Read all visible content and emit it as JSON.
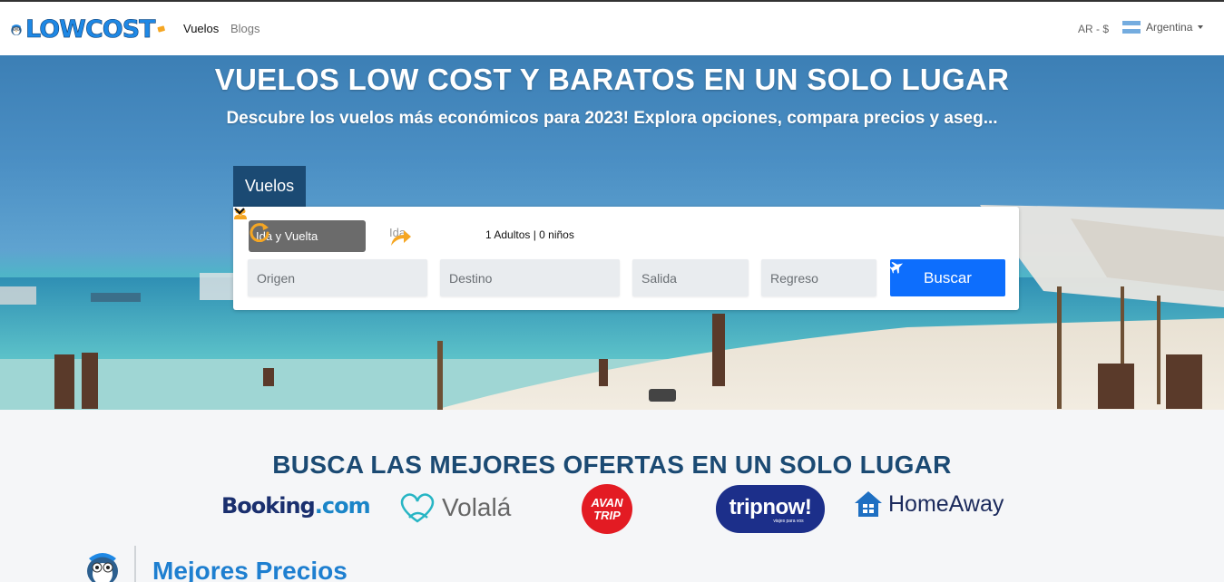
{
  "navbar": {
    "logo_text": "LOWCOST",
    "links": [
      "Vuelos",
      "Blogs"
    ],
    "currency": "AR - $",
    "country": "Argentina"
  },
  "hero": {
    "title": "VUELOS LOW COST Y BARATOS EN UN SOLO LUGAR",
    "subtitle": "Descubre los vuelos más económicos para 2023! Explora opciones, compara precios y aseg..."
  },
  "search": {
    "tab_label": "Vuelos",
    "trip_round_label": "Ida y Vuelta",
    "trip_oneway_label": "Ida",
    "passengers_label": "1 Adultos | 0 niños",
    "origin_placeholder": "Origen",
    "destination_placeholder": "Destino",
    "departure_placeholder": "Salida",
    "return_placeholder": "Regreso",
    "submit_label": "Buscar"
  },
  "partners": {
    "title": "BUSCA LAS MEJORES OFERTAS EN UN SOLO LUGAR",
    "booking_main": "Booking",
    "booking_suffix": ".com",
    "volala": "Volalá",
    "avantrip_line1": "AVAN",
    "avantrip_line2": "TRIP",
    "tripnow": "tripnow!",
    "tripnow_sub": "viajes para vos",
    "homeaway": "HomeAway"
  },
  "section": {
    "title": "Mejores Precios"
  },
  "colors": {
    "brand_blue": "#1e88e5",
    "navy": "#1b4a73",
    "primary_button": "#0d6efd"
  }
}
